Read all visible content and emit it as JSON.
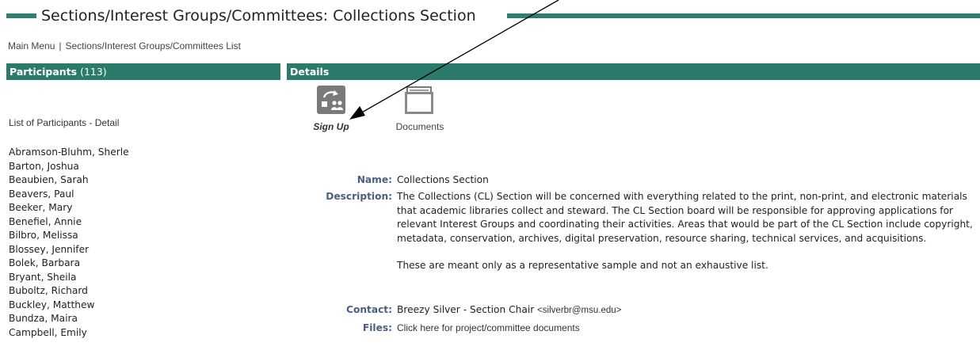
{
  "header": {
    "title": "Sections/Interest Groups/Committees: Collections Section"
  },
  "nav": {
    "main_menu": "Main Menu",
    "separator": "|",
    "list_link": "Sections/Interest Groups/Committees List"
  },
  "participants": {
    "header_label": "Participants",
    "count": "(113)",
    "caption": "List of Participants - Detail",
    "names": [
      "Abramson-Bluhm, Sherle",
      "Barton, Joshua",
      "Beaubien, Sarah",
      "Beavers, Paul",
      "Beeker, Mary",
      "Benefiel, Annie",
      "Bilbro, Melissa",
      "Blossey, Jennifer",
      "Bolek, Barbara",
      "Bryant, Sheila",
      "Buboltz, Richard",
      "Buckley, Matthew",
      "Bundza, Maira",
      "Campbell, Emily"
    ]
  },
  "details": {
    "header_label": "Details",
    "tools": {
      "sign_up": "Sign Up",
      "documents": "Documents"
    },
    "name_label": "Name:",
    "name_value": "Collections Section",
    "description_label": "Description:",
    "description_p1": "The Collections (CL) Section will be concerned with everything related to the print, non-print, and electronic materials that academic libraries collect and steward. The CL Section board will be responsible for approving applications for relevant Interest Groups and coordinating their activities. Areas that would be part of the CL Section include copyright, metadata, conservation, archives, digital preservation, resource sharing, technical services, and acquisitions.",
    "description_p2": "These are meant only as a representative sample and not an exhaustive list.",
    "contact_label": "Contact:",
    "contact_value": "Breezy Silver - Section Chair",
    "contact_email": "<silverbr@msu.edu>",
    "files_label": "Files:",
    "files_link": "Click here for project/committee documents"
  },
  "colors": {
    "header_bar": "#2a7b6c",
    "title_rule": "#2f7f71",
    "label_blue": "#4a5e85"
  }
}
